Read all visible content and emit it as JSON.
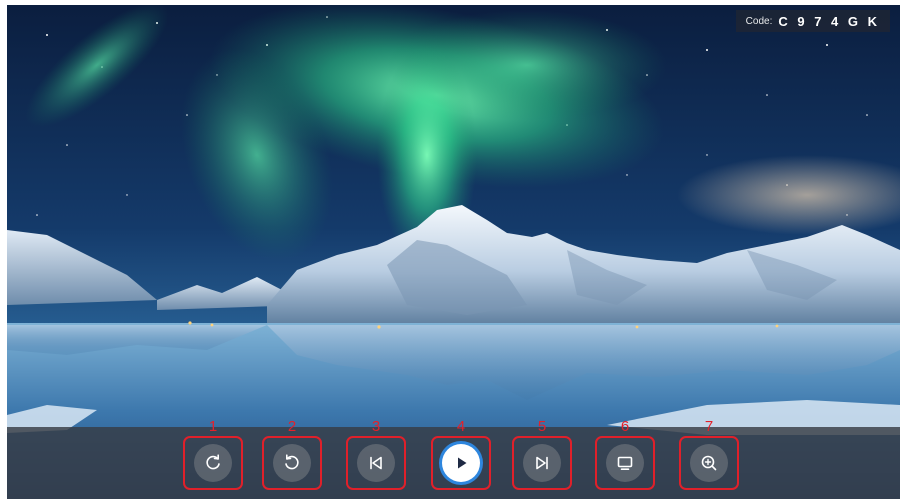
{
  "code_badge": {
    "label": "Code:",
    "value": "C 9 7 4 G K"
  },
  "controls": [
    {
      "number": "1",
      "icon": "rotate-clockwise-icon"
    },
    {
      "number": "2",
      "icon": "rotate-counterclockwise-icon"
    },
    {
      "number": "3",
      "icon": "previous-icon"
    },
    {
      "number": "4",
      "icon": "play-icon",
      "active": true
    },
    {
      "number": "5",
      "icon": "next-icon"
    },
    {
      "number": "6",
      "icon": "display-icon"
    },
    {
      "number": "7",
      "icon": "zoom-in-icon"
    }
  ],
  "colors": {
    "highlight_border": "#e0202a",
    "number_label": "#e3212b",
    "active_ring": "#2e86de",
    "control_bar": "#373c44"
  }
}
